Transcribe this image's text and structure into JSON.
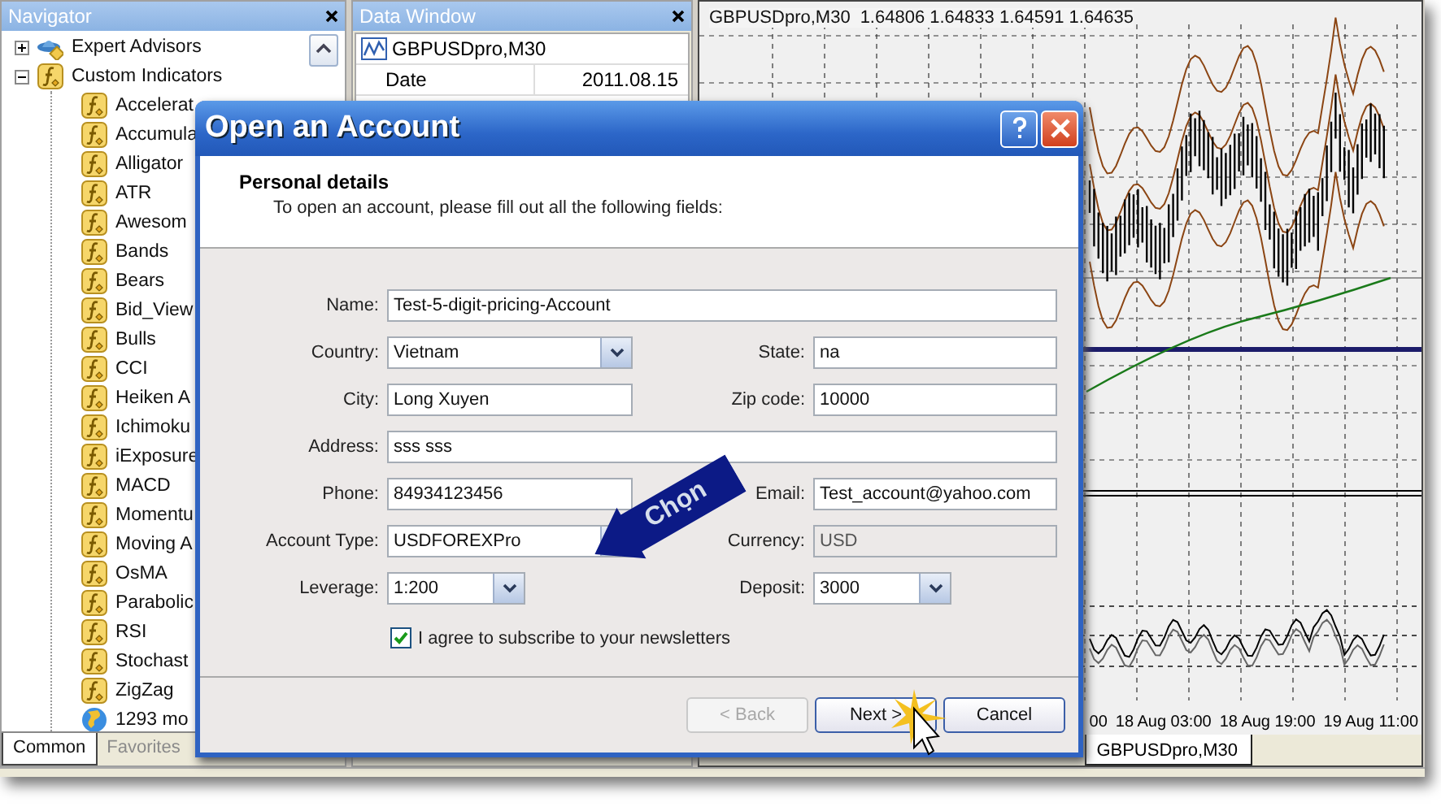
{
  "navigator": {
    "title": "Navigator",
    "items": [
      {
        "label": "Expert Advisors",
        "kind": "expert",
        "expanded": false
      },
      {
        "label": "Custom Indicators",
        "kind": "indicator",
        "expanded": true,
        "children": [
          {
            "label": "Accelerat",
            "kind": "indicator"
          },
          {
            "label": "Accumula",
            "kind": "indicator"
          },
          {
            "label": "Alligator",
            "kind": "indicator"
          },
          {
            "label": "ATR",
            "kind": "indicator"
          },
          {
            "label": "Awesom",
            "kind": "indicator"
          },
          {
            "label": "Bands",
            "kind": "indicator"
          },
          {
            "label": "Bears",
            "kind": "indicator"
          },
          {
            "label": "Bid_View",
            "kind": "indicator"
          },
          {
            "label": "Bulls",
            "kind": "indicator"
          },
          {
            "label": "CCI",
            "kind": "indicator"
          },
          {
            "label": "Heiken A",
            "kind": "indicator"
          },
          {
            "label": "Ichimoku",
            "kind": "indicator"
          },
          {
            "label": "iExposure",
            "kind": "indicator"
          },
          {
            "label": "MACD",
            "kind": "indicator"
          },
          {
            "label": "Momentu",
            "kind": "indicator"
          },
          {
            "label": "Moving A",
            "kind": "indicator"
          },
          {
            "label": "OsMA",
            "kind": "indicator"
          },
          {
            "label": "Parabolic",
            "kind": "indicator"
          },
          {
            "label": "RSI",
            "kind": "indicator"
          },
          {
            "label": "Stochast",
            "kind": "indicator"
          },
          {
            "label": "ZigZag",
            "kind": "indicator"
          },
          {
            "label": "1293 mo",
            "kind": "market"
          }
        ]
      }
    ],
    "tabs": [
      {
        "label": "Common",
        "selected": true
      },
      {
        "label": "Favorites",
        "selected": false
      }
    ]
  },
  "data_window": {
    "title": "Data Window",
    "symbol": "GBPUSDpro,M30",
    "rows": [
      {
        "label": "Date",
        "value": "2011.08.15"
      }
    ]
  },
  "chart": {
    "symbol": "GBPUSDpro,M30",
    "prices": "1.64806 1.64833 1.64591 1.64635",
    "time_labels": [
      "00",
      "18 Aug 03:00",
      "18 Aug 19:00",
      "19 Aug 11:00"
    ],
    "tab": "GBPUSDpro,M30"
  },
  "dialog": {
    "title": "Open an Account",
    "heading": "Personal details",
    "instruction": "To open an account, please fill out all the following fields:",
    "rows": [
      [
        {
          "label": "Name:",
          "value": "Test-5-digit-pricing-Account",
          "kind": "wide"
        }
      ],
      [
        {
          "label": "Country:",
          "value": "Vietnam",
          "kind": "combo"
        },
        {
          "label": "State:",
          "value": "na",
          "kind": "text"
        }
      ],
      [
        {
          "label": "City:",
          "value": "Long Xuyen",
          "kind": "text"
        },
        {
          "label": "Zip code:",
          "value": "10000",
          "kind": "text"
        }
      ],
      [
        {
          "label": "Address:",
          "value": "sss sss",
          "kind": "wide"
        }
      ],
      [
        {
          "label": "Phone:",
          "value": "84934123456",
          "kind": "text"
        },
        {
          "label": "Email:",
          "value": "Test_account@yahoo.com",
          "kind": "text"
        }
      ],
      [
        {
          "label": "Account Type:",
          "value": "USDFOREXPro",
          "kind": "combo"
        },
        {
          "label": "Currency:",
          "value": "USD",
          "kind": "readonly"
        }
      ],
      [
        {
          "label": "Leverage:",
          "value": "1:200",
          "kind": "small-combo"
        },
        {
          "label": "Deposit:",
          "value": "3000",
          "kind": "small-combo"
        }
      ]
    ],
    "newsletter": {
      "label": "I agree to subscribe to your newsletters",
      "checked": true
    },
    "buttons": [
      {
        "label": "< Back",
        "disabled": true
      },
      {
        "label": "Next >",
        "disabled": false
      },
      {
        "label": "Cancel",
        "disabled": false
      }
    ],
    "callout": "Chọn"
  }
}
